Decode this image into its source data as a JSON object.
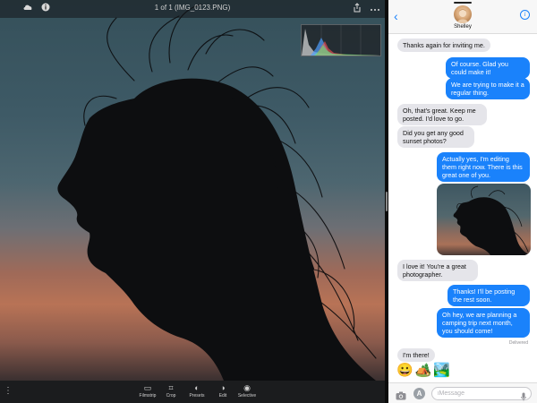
{
  "editor": {
    "title": "1 of 1 (IMG_0123.PNG)",
    "top_icons": {
      "left": [
        "cloud-icon",
        "info-icon"
      ],
      "right": [
        "share-icon",
        "more-icon"
      ]
    },
    "tools": [
      {
        "label": "Filmstrip",
        "icon": "filmstrip-icon",
        "glyph": "▭"
      },
      {
        "label": "Crop",
        "icon": "crop-icon",
        "glyph": "⌗"
      },
      {
        "label": "Presets",
        "icon": "presets-icon",
        "glyph": "◐"
      },
      {
        "label": "Edit",
        "icon": "edit-icon",
        "glyph": "◑"
      },
      {
        "label": "Selective",
        "icon": "selective-icon",
        "glyph": "◉"
      }
    ]
  },
  "messages": {
    "contact_name": "Shelley",
    "conversation": [
      {
        "from": "in",
        "text": "Thanks again for inviting me."
      },
      {
        "from": "out",
        "text": "Of course. Glad you could make it!"
      },
      {
        "from": "out",
        "text": "We are trying to make it a regular thing."
      },
      {
        "from": "in",
        "text": "Oh, that's great. Keep me posted. I'd love to go."
      },
      {
        "from": "in",
        "text": "Did you get any good sunset photos?"
      },
      {
        "from": "out",
        "text": "Actually yes, I'm editing them right now. There is this great one of you."
      },
      {
        "from": "in",
        "text": "I love it! You're a great photographer."
      },
      {
        "from": "out",
        "text": "Thanks! I'll be posting the rest soon."
      },
      {
        "from": "out",
        "text": "Oh hey, we are planning a camping trip next month, you should come!"
      },
      {
        "from": "in",
        "text": "I'm there!"
      }
    ],
    "status": "Delivered",
    "emoji": [
      "😀",
      "🏕️",
      "🏞️"
    ],
    "input_placeholder": "iMessage"
  },
  "colors": {
    "imessage_blue": "#1a82fb",
    "incoming_gray": "#e5e5ea",
    "editor_bar": "#1b1c1e"
  }
}
